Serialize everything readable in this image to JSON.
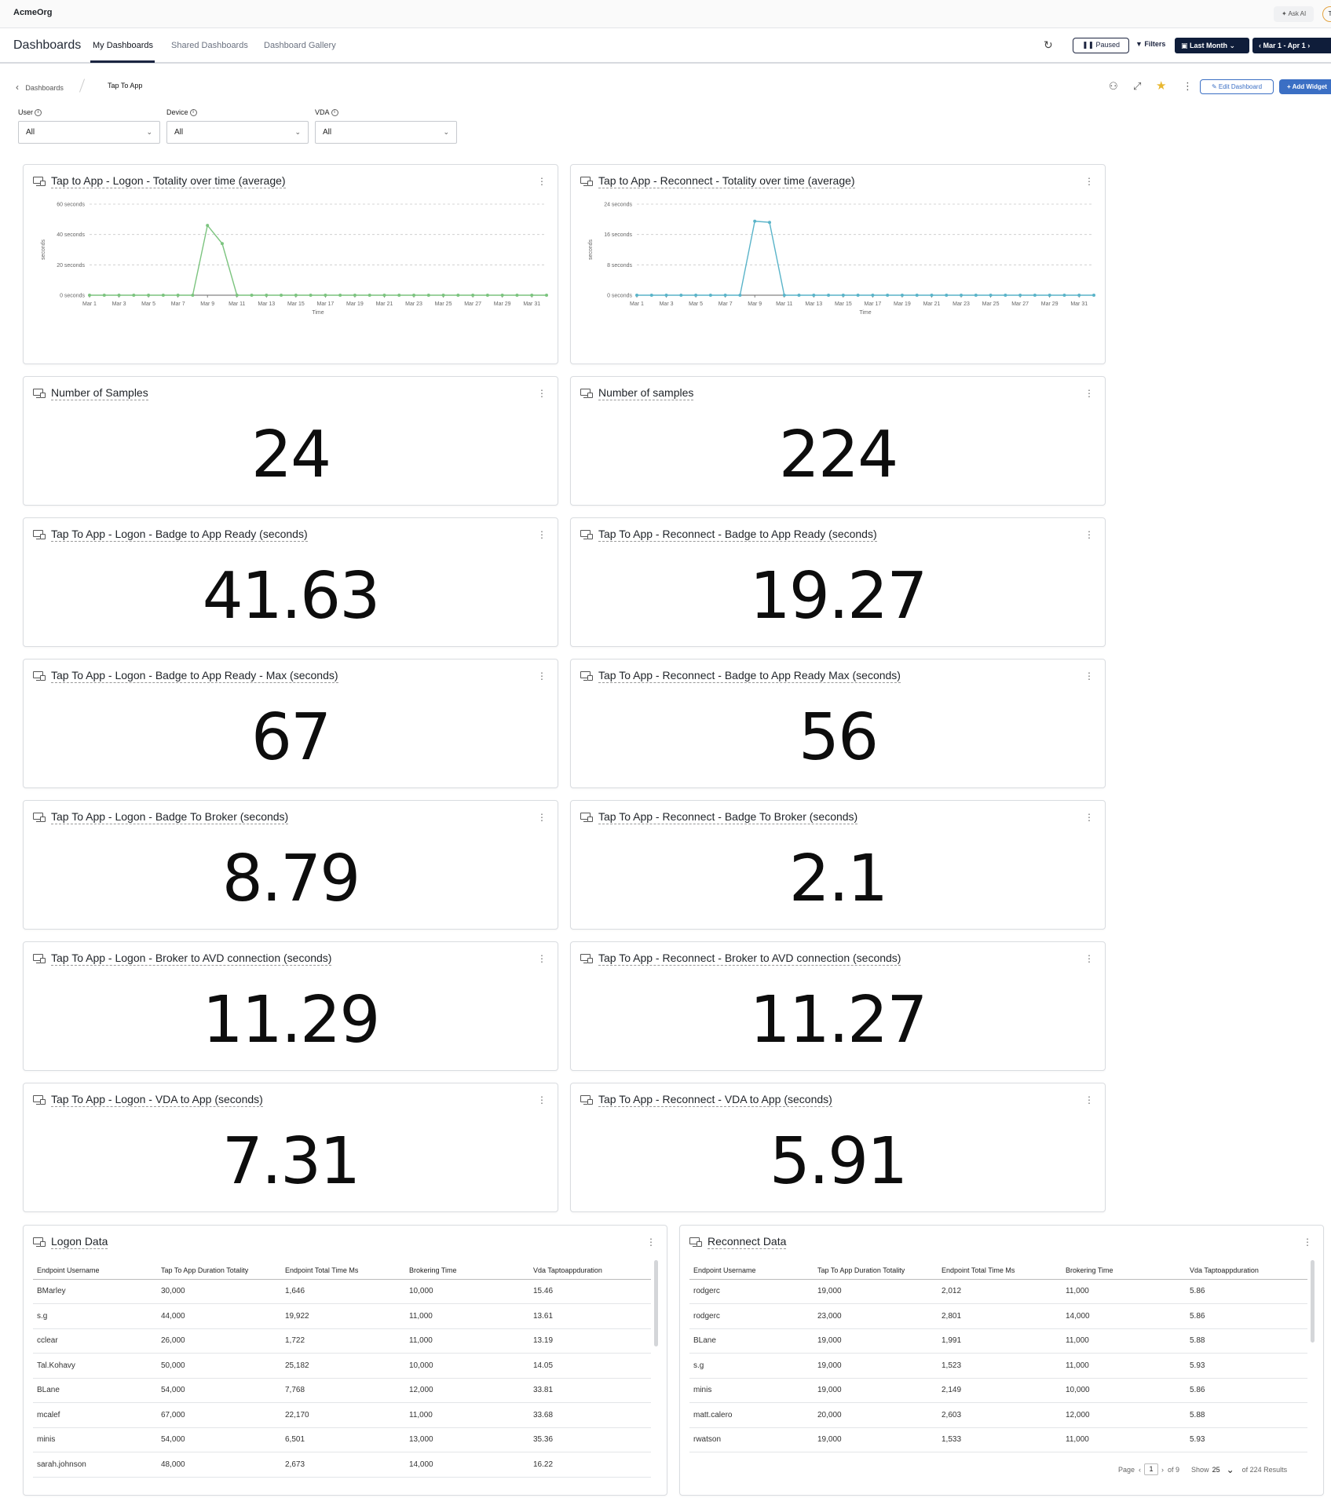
{
  "topbar": {
    "org": "AcmeOrg",
    "ask_ai": "Ask AI",
    "avatar": "T"
  },
  "nav": {
    "title": "Dashboards",
    "tabs": [
      "My Dashboards",
      "Shared Dashboards",
      "Dashboard Gallery"
    ],
    "paused": "Paused",
    "filters": "Filters",
    "last_month": "Last Month",
    "date_range": "Mar 1 - Apr 1"
  },
  "breadcrumb": {
    "parent": "Dashboards",
    "current": "Tap To App"
  },
  "actions": {
    "edit": "Edit Dashboard",
    "add": "Add Widget"
  },
  "filters": [
    {
      "label": "User",
      "value": "All"
    },
    {
      "label": "Device",
      "value": "All"
    },
    {
      "label": "VDA",
      "value": "All"
    }
  ],
  "colors": {
    "logon_line": "#7cc47f",
    "reconnect_line": "#5ab4c9",
    "accent": "#3b6fc4",
    "nav_dark": "#0f1d3a"
  },
  "charts": {
    "logon": {
      "title": "Tap to App - Logon - Totality over time (average)",
      "chart_data": {
        "type": "line",
        "title": "Tap to App - Logon - Totality over time (average)",
        "xlabel": "Time",
        "ylabel": "seconds",
        "x": [
          "Mar 1",
          "Mar 2",
          "Mar 3",
          "Mar 4",
          "Mar 5",
          "Mar 6",
          "Mar 7",
          "Mar 8",
          "Mar 9",
          "Mar 10",
          "Mar 11",
          "Mar 12",
          "Mar 13",
          "Mar 14",
          "Mar 15",
          "Mar 16",
          "Mar 17",
          "Mar 18",
          "Mar 19",
          "Mar 20",
          "Mar 21",
          "Mar 22",
          "Mar 23",
          "Mar 24",
          "Mar 25",
          "Mar 26",
          "Mar 27",
          "Mar 28",
          "Mar 29",
          "Mar 30",
          "Mar 31",
          "Apr 1"
        ],
        "series": [
          {
            "name": "",
            "values": [
              0,
              0,
              0,
              0,
              0,
              0,
              0,
              0,
              46,
              34,
              0,
              0,
              0,
              0,
              0,
              0,
              0,
              0,
              0,
              0,
              0,
              0,
              0,
              0,
              0,
              0,
              0,
              0,
              0,
              0,
              0,
              0
            ]
          }
        ],
        "ylim": [
          0,
          60
        ],
        "yticks": [
          0,
          20,
          40,
          60
        ],
        "ytick_labels": [
          "0 seconds",
          "20 seconds",
          "40 seconds",
          "60 seconds"
        ],
        "xtick_labels": [
          "Mar 1",
          "Mar 3",
          "Mar 5",
          "Mar 7",
          "Mar 9",
          "Mar 11",
          "Mar 13",
          "Mar 15",
          "Mar 17",
          "Mar 19",
          "Mar 21",
          "Mar 23",
          "Mar 25",
          "Mar 27",
          "Mar 29",
          "Mar 31"
        ],
        "grid": true
      }
    },
    "reconnect": {
      "title": "Tap to App - Reconnect - Totality over time (average)",
      "chart_data": {
        "type": "line",
        "title": "Tap to App - Reconnect - Totality over time (average)",
        "xlabel": "Time",
        "ylabel": "seconds",
        "x": [
          "Mar 1",
          "Mar 2",
          "Mar 3",
          "Mar 4",
          "Mar 5",
          "Mar 6",
          "Mar 7",
          "Mar 8",
          "Mar 9",
          "Mar 10",
          "Mar 11",
          "Mar 12",
          "Mar 13",
          "Mar 14",
          "Mar 15",
          "Mar 16",
          "Mar 17",
          "Mar 18",
          "Mar 19",
          "Mar 20",
          "Mar 21",
          "Mar 22",
          "Mar 23",
          "Mar 24",
          "Mar 25",
          "Mar 26",
          "Mar 27",
          "Mar 28",
          "Mar 29",
          "Mar 30",
          "Mar 31",
          "Apr 1"
        ],
        "series": [
          {
            "name": "",
            "values": [
              0,
              0,
              0,
              0,
              0,
              0,
              0,
              0,
              19.5,
              19.2,
              0,
              0,
              0,
              0,
              0,
              0,
              0,
              0,
              0,
              0,
              0,
              0,
              0,
              0,
              0,
              0,
              0,
              0,
              0,
              0,
              0,
              0
            ]
          }
        ],
        "ylim": [
          0,
          24
        ],
        "yticks": [
          0,
          8,
          16,
          24
        ],
        "ytick_labels": [
          "0 seconds",
          "8 seconds",
          "16 seconds",
          "24 seconds"
        ],
        "xtick_labels": [
          "Mar 1",
          "Mar 3",
          "Mar 5",
          "Mar 7",
          "Mar 9",
          "Mar 11",
          "Mar 13",
          "Mar 15",
          "Mar 17",
          "Mar 19",
          "Mar 21",
          "Mar 23",
          "Mar 25",
          "Mar 27",
          "Mar 29",
          "Mar 31"
        ],
        "grid": true
      }
    }
  },
  "metrics": [
    {
      "left": {
        "title": "Number of Samples",
        "value": "24"
      },
      "right": {
        "title": "Number of samples",
        "value": "224"
      }
    },
    {
      "left": {
        "title": "Tap To App - Logon - Badge to App Ready (seconds)",
        "value": "41.63"
      },
      "right": {
        "title": "Tap To App - Reconnect - Badge to App Ready (seconds)",
        "value": "19.27"
      }
    },
    {
      "left": {
        "title": "Tap To App - Logon - Badge to App Ready - Max (seconds)",
        "value": "67"
      },
      "right": {
        "title": "Tap To App - Reconnect - Badge to App Ready Max (seconds)",
        "value": "56"
      }
    },
    {
      "left": {
        "title": "Tap To App - Logon - Badge To Broker (seconds)",
        "value": "8.79"
      },
      "right": {
        "title": "Tap To App - Reconnect - Badge To Broker (seconds)",
        "value": "2.1"
      }
    },
    {
      "left": {
        "title": "Tap To App - Logon - Broker to AVD connection (seconds)",
        "value": "11.29"
      },
      "right": {
        "title": "Tap To App - Reconnect - Broker to AVD connection (seconds)",
        "value": "11.27"
      }
    },
    {
      "left": {
        "title": "Tap To App - Logon - VDA to App (seconds)",
        "value": "7.31"
      },
      "right": {
        "title": "Tap To App - Reconnect - VDA to App (seconds)",
        "value": "5.91"
      }
    }
  ],
  "logon_table": {
    "title": "Logon Data",
    "columns": [
      "Endpoint Username",
      "Tap To App Duration Totality",
      "Endpoint Total Time Ms",
      "Brokering Time",
      "Vda Taptoappduration"
    ],
    "rows": [
      [
        "BMarley",
        "30,000",
        "1,646",
        "10,000",
        "15.46"
      ],
      [
        "s.g",
        "44,000",
        "19,922",
        "11,000",
        "13.61"
      ],
      [
        "cclear",
        "26,000",
        "1,722",
        "11,000",
        "13.19"
      ],
      [
        "Tal.Kohavy",
        "50,000",
        "25,182",
        "10,000",
        "14.05"
      ],
      [
        "BLane",
        "54,000",
        "7,768",
        "12,000",
        "33.81"
      ],
      [
        "mcalef",
        "67,000",
        "22,170",
        "11,000",
        "33.68"
      ],
      [
        "minis",
        "54,000",
        "6,501",
        "13,000",
        "35.36"
      ],
      [
        "sarah.johnson",
        "48,000",
        "2,673",
        "14,000",
        "16.22"
      ]
    ]
  },
  "reconnect_table": {
    "title": "Reconnect Data",
    "columns": [
      "Endpoint Username",
      "Tap To App Duration Totality",
      "Endpoint Total Time Ms",
      "Brokering Time",
      "Vda Taptoappduration"
    ],
    "rows": [
      [
        "rodgerc",
        "19,000",
        "2,012",
        "11,000",
        "5.86"
      ],
      [
        "rodgerc",
        "23,000",
        "2,801",
        "14,000",
        "5.86"
      ],
      [
        "BLane",
        "19,000",
        "1,991",
        "11,000",
        "5.88"
      ],
      [
        "s.g",
        "19,000",
        "1,523",
        "11,000",
        "5.93"
      ],
      [
        "minis",
        "19,000",
        "2,149",
        "10,000",
        "5.86"
      ],
      [
        "matt.calero",
        "20,000",
        "2,603",
        "12,000",
        "5.88"
      ],
      [
        "rwatson",
        "19,000",
        "1,533",
        "11,000",
        "5.93"
      ]
    ],
    "pager": {
      "page_label": "Page",
      "page": "1",
      "of_pages": "of 9",
      "show_label": "Show",
      "show": "25",
      "results": "of 224 Results"
    }
  }
}
